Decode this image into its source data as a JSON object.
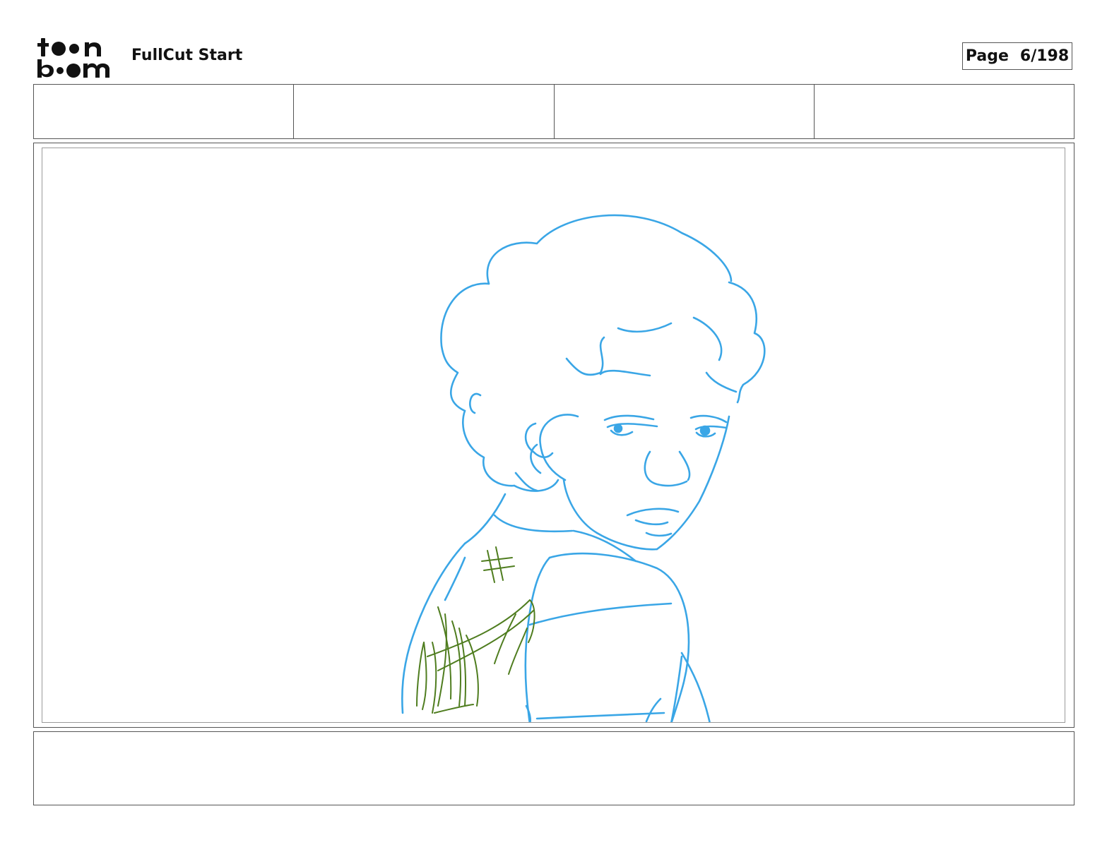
{
  "header": {
    "logo_text": "toon boom",
    "project_title": "FullCut Start",
    "page_label": "Page",
    "page_number": "6/198"
  },
  "info_row": {
    "cells": [
      "",
      "",
      "",
      ""
    ]
  },
  "panel": {
    "sketch_colors": {
      "line": "#3aa6e6",
      "shading": "#4f7d1f"
    }
  },
  "caption": {
    "text": ""
  }
}
